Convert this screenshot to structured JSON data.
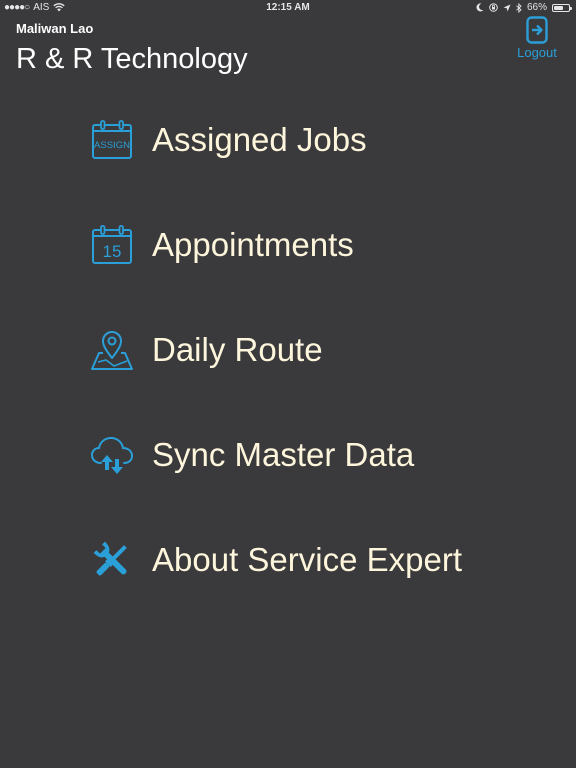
{
  "status_bar": {
    "carrier": "AIS",
    "time": "12:15 AM",
    "battery_percent": "66%",
    "battery_level": 0.66
  },
  "header": {
    "user_name": "Maliwan Lao",
    "company_name": "R & R Technology",
    "logout_label": "Logout"
  },
  "menu": {
    "items": [
      {
        "label": "Assigned Jobs",
        "icon": "assign-calendar-icon",
        "icon_text": "ASSIGN"
      },
      {
        "label": "Appointments",
        "icon": "calendar-icon",
        "icon_text": "15"
      },
      {
        "label": "Daily Route",
        "icon": "map-pin-icon"
      },
      {
        "label": "Sync Master Data",
        "icon": "cloud-sync-icon"
      },
      {
        "label": "About Service Expert",
        "icon": "tools-icon"
      }
    ]
  },
  "colors": {
    "background": "#3a393b",
    "accent": "#2a9fd8",
    "menu_text": "#fdf6dc",
    "header_text": "#ffffff"
  }
}
